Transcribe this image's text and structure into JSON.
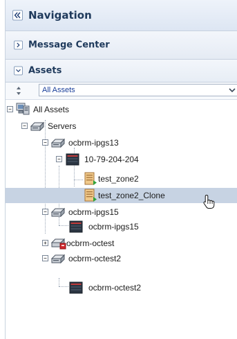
{
  "navigation": {
    "title": "Navigation"
  },
  "message_center": {
    "title": "Message Center"
  },
  "assets": {
    "title": "Assets",
    "filter": {
      "selected": "All Assets"
    }
  },
  "tree": {
    "root": {
      "label": "All Assets",
      "expanded": true
    },
    "servers": {
      "label": "Servers",
      "expanded": true
    },
    "nodes": [
      {
        "label": "ocbrm-ipgs13",
        "expanded": true
      },
      {
        "label": "10-79-204-204",
        "expanded": true
      },
      {
        "label": "test_zone2"
      },
      {
        "label": "test_zone2_Clone",
        "selected": true
      },
      {
        "label": "ocbrm-ipgs15",
        "expanded": true
      },
      {
        "label": "ocbrm-ipgs15"
      },
      {
        "label": "ocbrm-octest",
        "expanded": false
      },
      {
        "label": "ocbrm-octest2",
        "expanded": true
      },
      {
        "label": "ocbrm-octest2"
      }
    ]
  },
  "colors": {
    "accent": "#1f3a5c",
    "selection": "#c7d3e3",
    "link": "#1a3f9a"
  }
}
